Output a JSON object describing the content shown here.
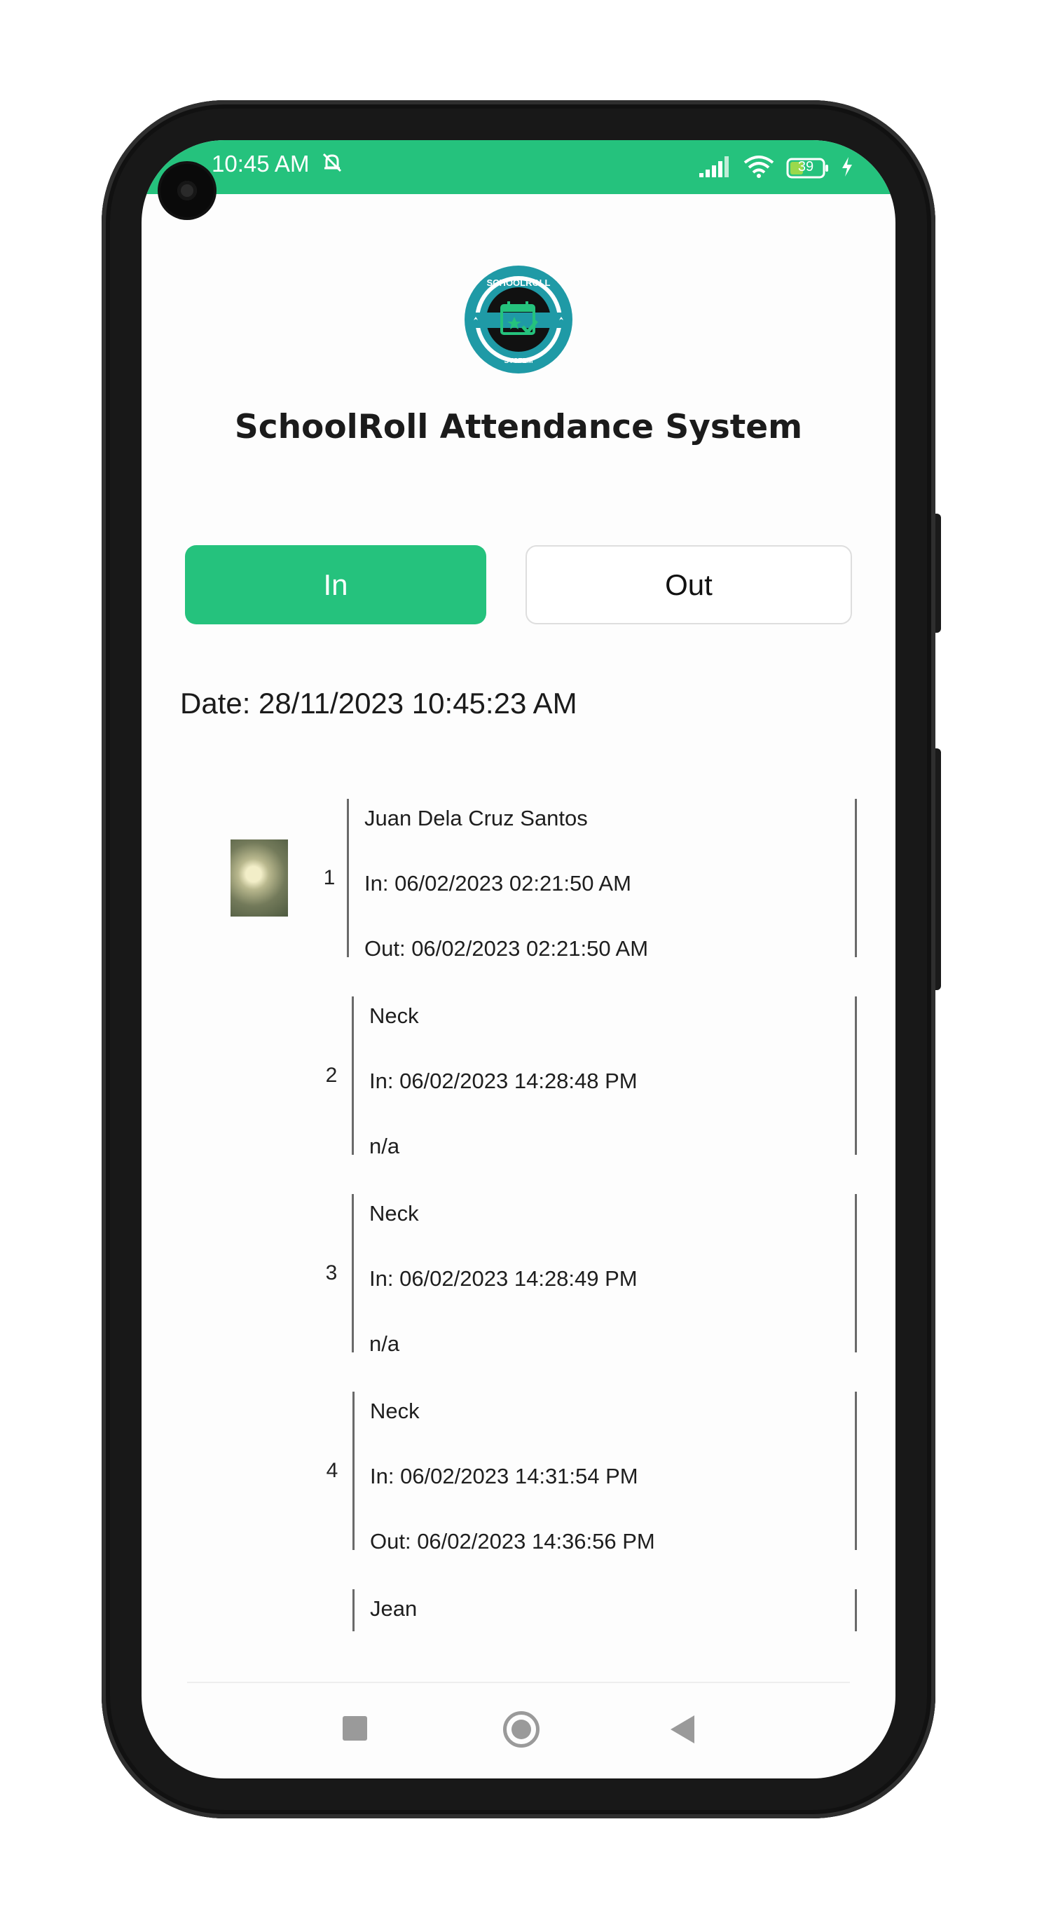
{
  "status_bar": {
    "time": "10:45 AM",
    "battery_level": "39",
    "icons": [
      "silent-icon",
      "signal-icon",
      "wifi-icon",
      "battery-icon",
      "charging-icon"
    ],
    "color": "#25c27d"
  },
  "header": {
    "logo_top_text": "SCHOOLROLL",
    "logo_bottom_text": "SYSTEM",
    "title": "SchoolRoll Attendance System"
  },
  "toggle": {
    "in_label": "In",
    "out_label": "Out",
    "selected": "In",
    "accent_color": "#25c27d"
  },
  "date_label": "Date: 28/11/2023 10:45:23 AM",
  "records": [
    {
      "num": "1",
      "name": "Juan Dela Cruz Santos",
      "in": "In: 06/02/2023 02:21:50 AM",
      "out": "Out: 06/02/2023 02:21:50 AM"
    },
    {
      "num": "2",
      "name": "Neck",
      "in": "In: 06/02/2023 14:28:48 PM",
      "out": "n/a"
    },
    {
      "num": "3",
      "name": "Neck",
      "in": "In: 06/02/2023 14:28:49 PM",
      "out": "n/a"
    },
    {
      "num": "4",
      "name": "Neck",
      "in": "In: 06/02/2023 14:31:54 PM",
      "out": "Out: 06/02/2023 14:36:56 PM"
    },
    {
      "num": "",
      "name": "Jean",
      "in": "",
      "out": ""
    }
  ],
  "nav_bar": {
    "icons": [
      "recents-icon",
      "home-icon",
      "back-icon"
    ]
  }
}
